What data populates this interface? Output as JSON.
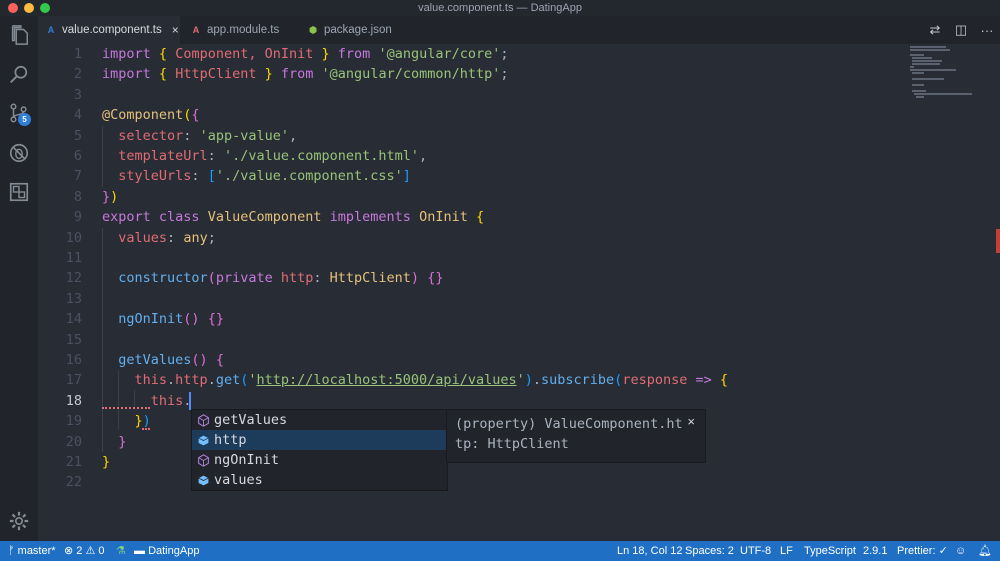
{
  "window": {
    "title": "value.component.ts — DatingApp"
  },
  "tabs": [
    {
      "label": "value.component.ts",
      "icon": "A",
      "icon_color": "#2f7fd8",
      "close": "×"
    },
    {
      "label": "app.module.ts",
      "icon": "A",
      "icon_color": "#e06c75"
    },
    {
      "label": "package.json",
      "icon": "⬢",
      "icon_color": "#8bc34a"
    }
  ],
  "tab_actions": {
    "compare": "⇄",
    "split": "◫",
    "more": "···"
  },
  "activity": {
    "scm_badge": "5"
  },
  "editor": {
    "line_numbers": [
      "1",
      "2",
      "3",
      "4",
      "5",
      "6",
      "7",
      "8",
      "9",
      "10",
      "11",
      "12",
      "13",
      "14",
      "15",
      "16",
      "17",
      "18",
      "19",
      "20",
      "21",
      "22"
    ],
    "current_line": "18",
    "code": {
      "l1": {
        "kw": "import",
        "b1": "{",
        "sp1": " Component, OnInit ",
        "b2": "}",
        "from": "from",
        "str": "'@angular/core'",
        "end": ";"
      },
      "l2": {
        "kw": "import",
        "b1": "{",
        "sp1": " HttpClient ",
        "b2": "}",
        "from": "from",
        "str": "'@angular/common/http'",
        "end": ";"
      },
      "l4": {
        "dec": "@Component",
        "p": "(",
        "b": "{"
      },
      "l5": {
        "key": "selector",
        "colon": ": ",
        "str": "'app-value'",
        "end": ","
      },
      "l6": {
        "key": "templateUrl",
        "colon": ": ",
        "str": "'./value.component.html'",
        "end": ","
      },
      "l7": {
        "key": "styleUrls",
        "colon": ": ",
        "b1": "[",
        "str": "'./value.component.css'",
        "b2": "]"
      },
      "l8": {
        "b": "}",
        "p": ")"
      },
      "l9": {
        "kw1": "export",
        "kw2": "class",
        "cls": "ValueComponent",
        "kw3": "implements",
        "iface": "OnInit",
        "b": "{"
      },
      "l10": {
        "var": "values",
        "colon": ": ",
        "type": "any",
        "end": ";"
      },
      "l12": {
        "fn": "constructor",
        "p1": "(",
        "kw": "private",
        "var": "http",
        "colon": ": ",
        "type": "HttpClient",
        "p2": ")",
        "b": "{}"
      },
      "l14": {
        "fn": "ngOnInit",
        "p": "()",
        "b": "{}"
      },
      "l16": {
        "fn": "getValues",
        "p": "()",
        "b": "{"
      },
      "l17": {
        "this": "this",
        "d1": ".",
        "prop": "http",
        "d2": ".",
        "fn": "get",
        "p1": "(",
        "q1": "'",
        "url": "http://localhost:5000/api/values",
        "q2": "'",
        "p2": ")",
        "d3": ".",
        "fn2": "subscribe",
        "p3": "(",
        "arg": "response",
        "arrow": "=>",
        "b": "{"
      },
      "l18": {
        "this": "this",
        "dot": "."
      },
      "l19": {
        "b": "}",
        "p": ")"
      },
      "l20": {
        "b": "}"
      },
      "l21": {
        "b": "}"
      }
    }
  },
  "suggest": {
    "items": [
      {
        "label": "getValues",
        "kind": "method"
      },
      {
        "label": "http",
        "kind": "field",
        "selected": true
      },
      {
        "label": "ngOnInit",
        "kind": "method"
      },
      {
        "label": "values",
        "kind": "field"
      }
    ],
    "detail": {
      "line1": "(property) ValueComponent.ht",
      "line2": "tp: HttpClient",
      "close": "×"
    }
  },
  "statusbar": {
    "branch": "master*",
    "errors": "2",
    "warnings": "0",
    "folder": "DatingApp",
    "position": "Ln 18, Col 12",
    "spaces": "Spaces: 2",
    "encoding": "UTF-8",
    "eol": "LF",
    "language": "TypeScript",
    "version": "2.9.1",
    "prettier": "Prettier: ✓"
  },
  "colors": {
    "accent": "#1f6fc5",
    "editor_bg": "#282c34",
    "sidebar_bg": "#21252b"
  }
}
